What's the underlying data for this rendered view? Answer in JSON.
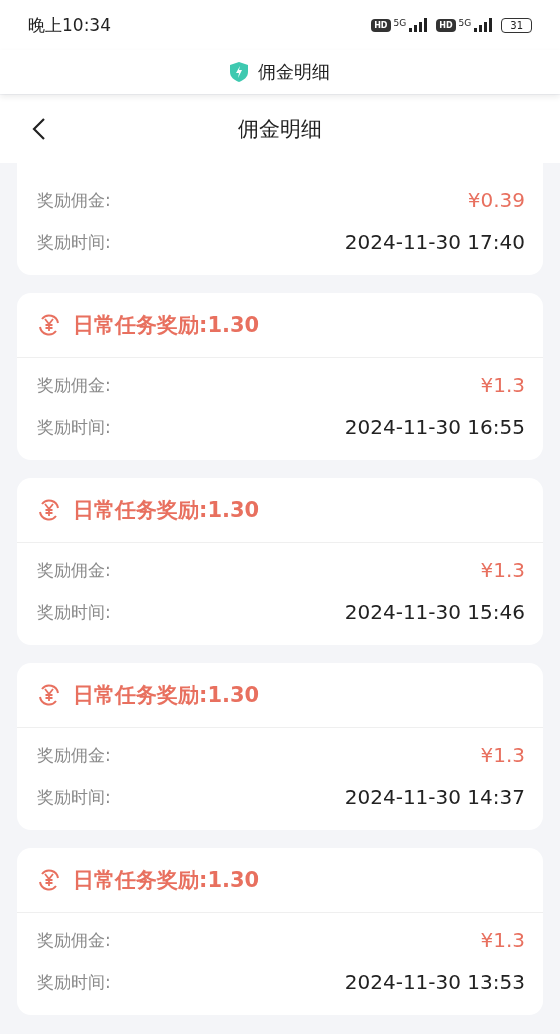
{
  "status_bar": {
    "time": "晚上10:34",
    "hd_badges": [
      "HD",
      "HD"
    ],
    "network": [
      "5G",
      "5G"
    ],
    "battery": "31"
  },
  "app_bar": {
    "title": "佣金明细"
  },
  "nav": {
    "title": "佣金明细"
  },
  "records": [
    {
      "amount_label": "奖励佣金:",
      "amount": "¥0.39",
      "time_label": "奖励时间:",
      "time": "2024-11-30 17:40"
    },
    {
      "title": "日常任务奖励:1.30",
      "amount_label": "奖励佣金:",
      "amount": "¥1.3",
      "time_label": "奖励时间:",
      "time": "2024-11-30 16:55"
    },
    {
      "title": "日常任务奖励:1.30",
      "amount_label": "奖励佣金:",
      "amount": "¥1.3",
      "time_label": "奖励时间:",
      "time": "2024-11-30 15:46"
    },
    {
      "title": "日常任务奖励:1.30",
      "amount_label": "奖励佣金:",
      "amount": "¥1.3",
      "time_label": "奖励时间:",
      "time": "2024-11-30 14:37"
    },
    {
      "title": "日常任务奖励:1.30",
      "amount_label": "奖励佣金:",
      "amount": "¥1.3",
      "time_label": "奖励时间:",
      "time": "2024-11-30 13:53"
    }
  ]
}
